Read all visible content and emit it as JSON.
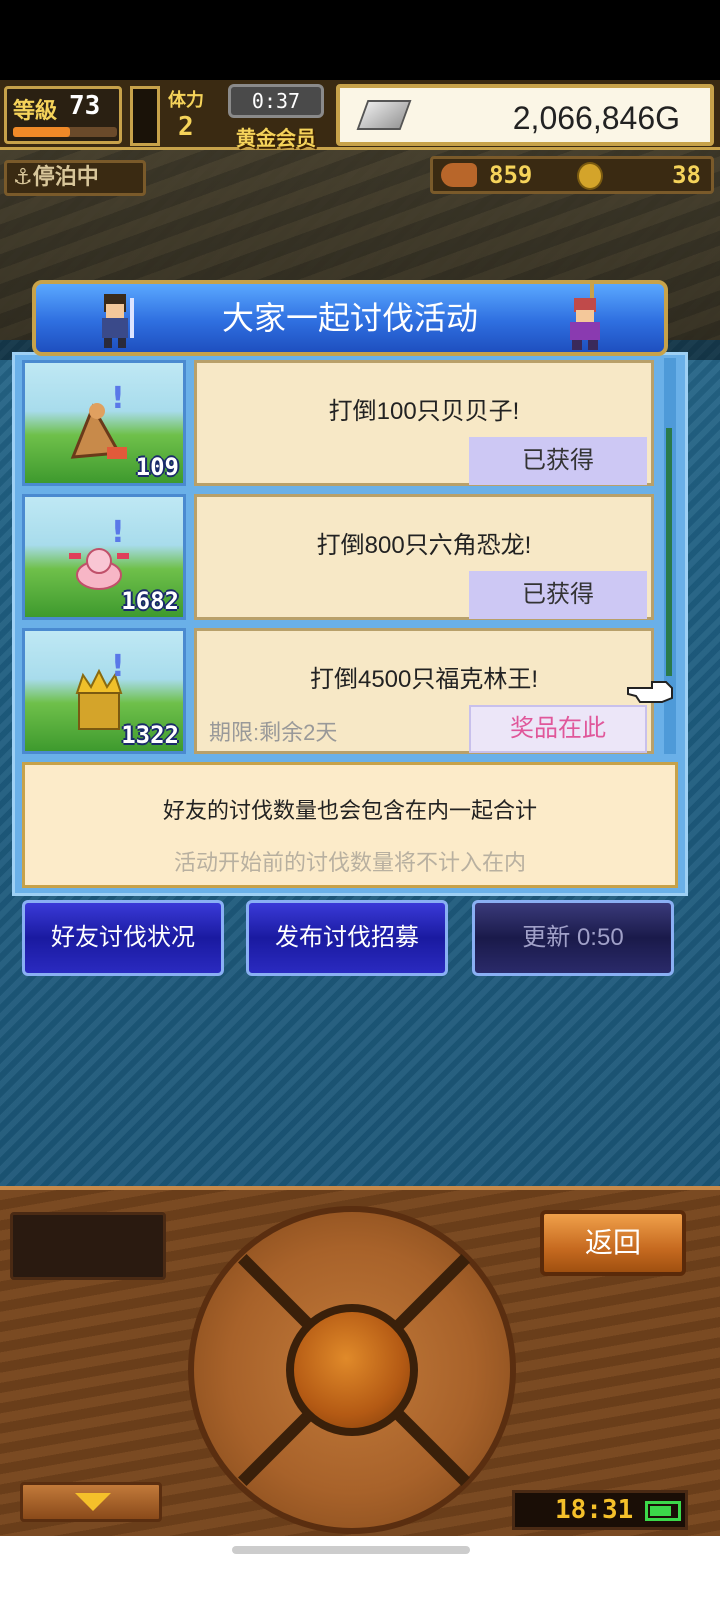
{
  "hud": {
    "level_label": "等級",
    "level_value": "73",
    "level_progress": 0.55,
    "stamina_label": "体力",
    "stamina_value": "2",
    "timer": "0:37",
    "membership": "黄金会员",
    "money": "2,066,846G",
    "moored_label": "停泊中",
    "meat_count": "859",
    "coin_count": "38"
  },
  "panel": {
    "title": "大家一起讨伐活动"
  },
  "quests": [
    {
      "title": "打倒100只贝贝子!",
      "count": "109",
      "status": "已获得",
      "creature": "hermit-crab"
    },
    {
      "title": "打倒800只六角恐龙!",
      "count": "1682",
      "status": "已获得",
      "creature": "axolotl"
    },
    {
      "title": "打倒4500只福克林王!",
      "count": "1322",
      "reward": "奖品在此",
      "deadline": "期限:剩余2天",
      "creature": "goblin-king"
    }
  ],
  "info": {
    "main": "好友的讨伐数量也会包含在内一起合计",
    "sub": "活动开始前的讨伐数量将不计入在内"
  },
  "buttons": {
    "friend_status": "好友讨伐状况",
    "post_recruit": "发布讨伐招募",
    "refresh": "更新 0:50"
  },
  "console": {
    "back": "返回",
    "clock": "18:31",
    "battery_level": 0.8
  },
  "colors": {
    "panel_blue": "#2f6fe0",
    "gold_border": "#c7a24a",
    "reward_pink": "#e0579a",
    "claimed_lavender": "#cdc8f4"
  }
}
